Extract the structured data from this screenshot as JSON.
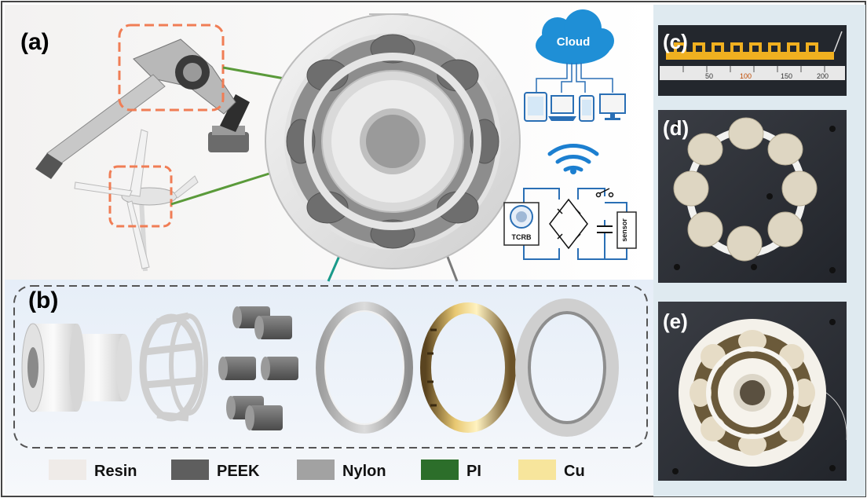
{
  "panels": {
    "a": "(a)",
    "b": "(b)",
    "c": "(c)",
    "d": "(d)",
    "e": "(e)"
  },
  "cloud_label": "Cloud",
  "circuit": {
    "generator_label": "TCRB",
    "load_label": "sensor"
  },
  "ruler_ticks": [
    "50",
    "100",
    "150",
    "200"
  ],
  "legend": [
    {
      "label": "Resin",
      "color": "#efebe8"
    },
    {
      "label": "PEEK",
      "color": "#5e5e5e"
    },
    {
      "label": "Nylon",
      "color": "#a2a2a2"
    },
    {
      "label": "PI",
      "color": "#2c6e2a"
    },
    {
      "label": "Cu",
      "color": "#f7e59c"
    }
  ],
  "colors": {
    "callout_box": "#f07d55",
    "connector_green": "#5a9a3a",
    "connector_teal": "#1a9a8a",
    "cloud_blue": "#1f8fd6",
    "device_blue": "#2a6fb5",
    "wifi_blue": "#1c7fd0"
  },
  "icons": [
    "robot-arm",
    "wind-turbine",
    "cloud-icon",
    "tablet-icon",
    "laptop-icon",
    "phone-icon",
    "monitor-icon",
    "wifi-icon",
    "bridge-rectifier",
    "capacitor",
    "switch"
  ]
}
